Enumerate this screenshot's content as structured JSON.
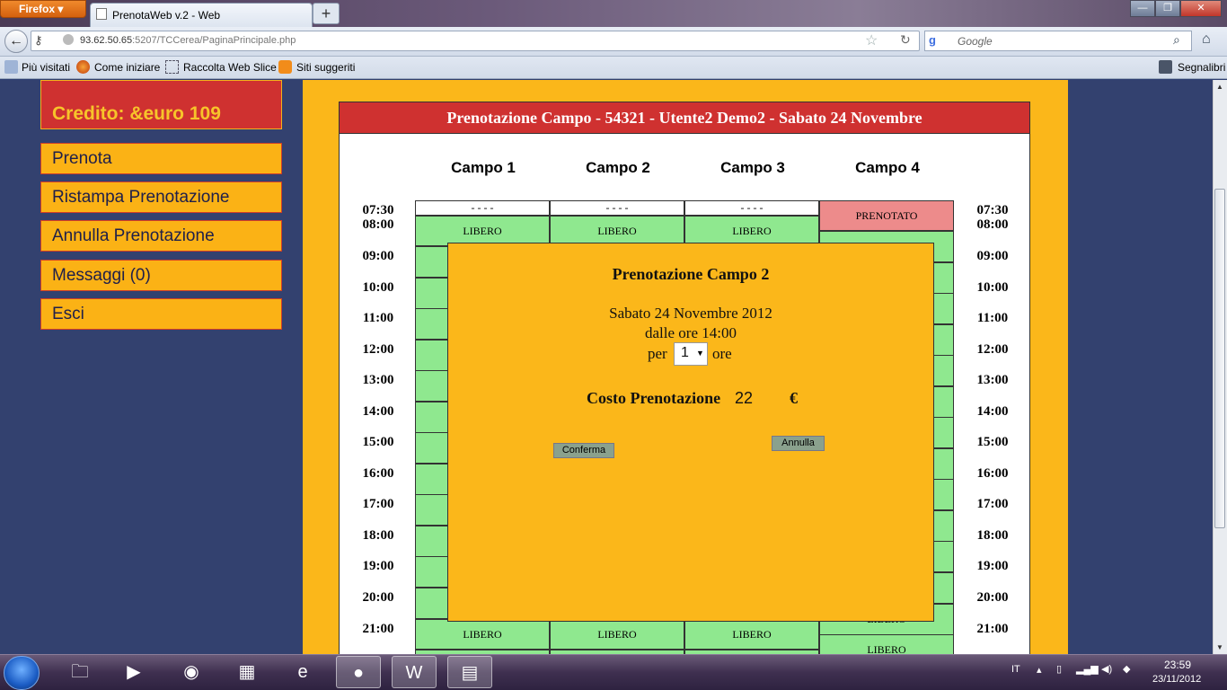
{
  "browser": {
    "app_button": "Firefox",
    "tab_title": "PrenotaWeb v.2 - Web",
    "tab_close": "×",
    "new_tab": "+",
    "window_buttons": [
      "—",
      "❐",
      "✕"
    ],
    "url_host": "93.62.50.65",
    "url_rest": ":5207/TCCerea/PaginaPrincipale.php",
    "search_placeholder": "Google",
    "bookmarks": [
      "Più visitati",
      "Come iniziare",
      "Raccolta Web Slice",
      "Siti suggeriti"
    ],
    "bookmarks_right": "Segnalibri"
  },
  "sidebar": {
    "credit": "Credito: &euro 109",
    "menu": [
      "Prenota",
      "Ristampa Prenotazione",
      "Annulla Prenotazione",
      "Messaggi (0)",
      "Esci"
    ]
  },
  "schedule": {
    "header": "Prenotazione Campo - 54321 - Utente2 Demo2 - Sabato 24 Novembre",
    "courts": [
      "Campo 1",
      "Campo 2",
      "Campo 3",
      "Campo 4"
    ],
    "times": [
      "07:30",
      "08:00",
      "09:00",
      "10:00",
      "11:00",
      "12:00",
      "13:00",
      "14:00",
      "15:00",
      "16:00",
      "17:00",
      "18:00",
      "19:00",
      "20:00",
      "21:00"
    ],
    "status_libero": "LIBERO",
    "status_prenotato": "PRENOTATO",
    "dashes": "- - - -"
  },
  "modal": {
    "title": "Prenotazione Campo 2",
    "date": "Sabato 24 Novembre 2012",
    "from": "dalle ore 14:00",
    "per": "per",
    "hours_selected": "1",
    "ore": "ore",
    "cost_label": "Costo Prenotazione",
    "cost_value": "22",
    "currency": "€",
    "confirm": "Conferma",
    "cancel": "Annulla"
  },
  "taskbar": {
    "lang": "IT",
    "time": "23:59",
    "date": "23/11/2012"
  },
  "colors": {
    "page_bg": "#33416f",
    "orange": "#fbb71a",
    "red": "#cf3130",
    "free": "#8fe88f",
    "booked": "#ed8b8b"
  }
}
